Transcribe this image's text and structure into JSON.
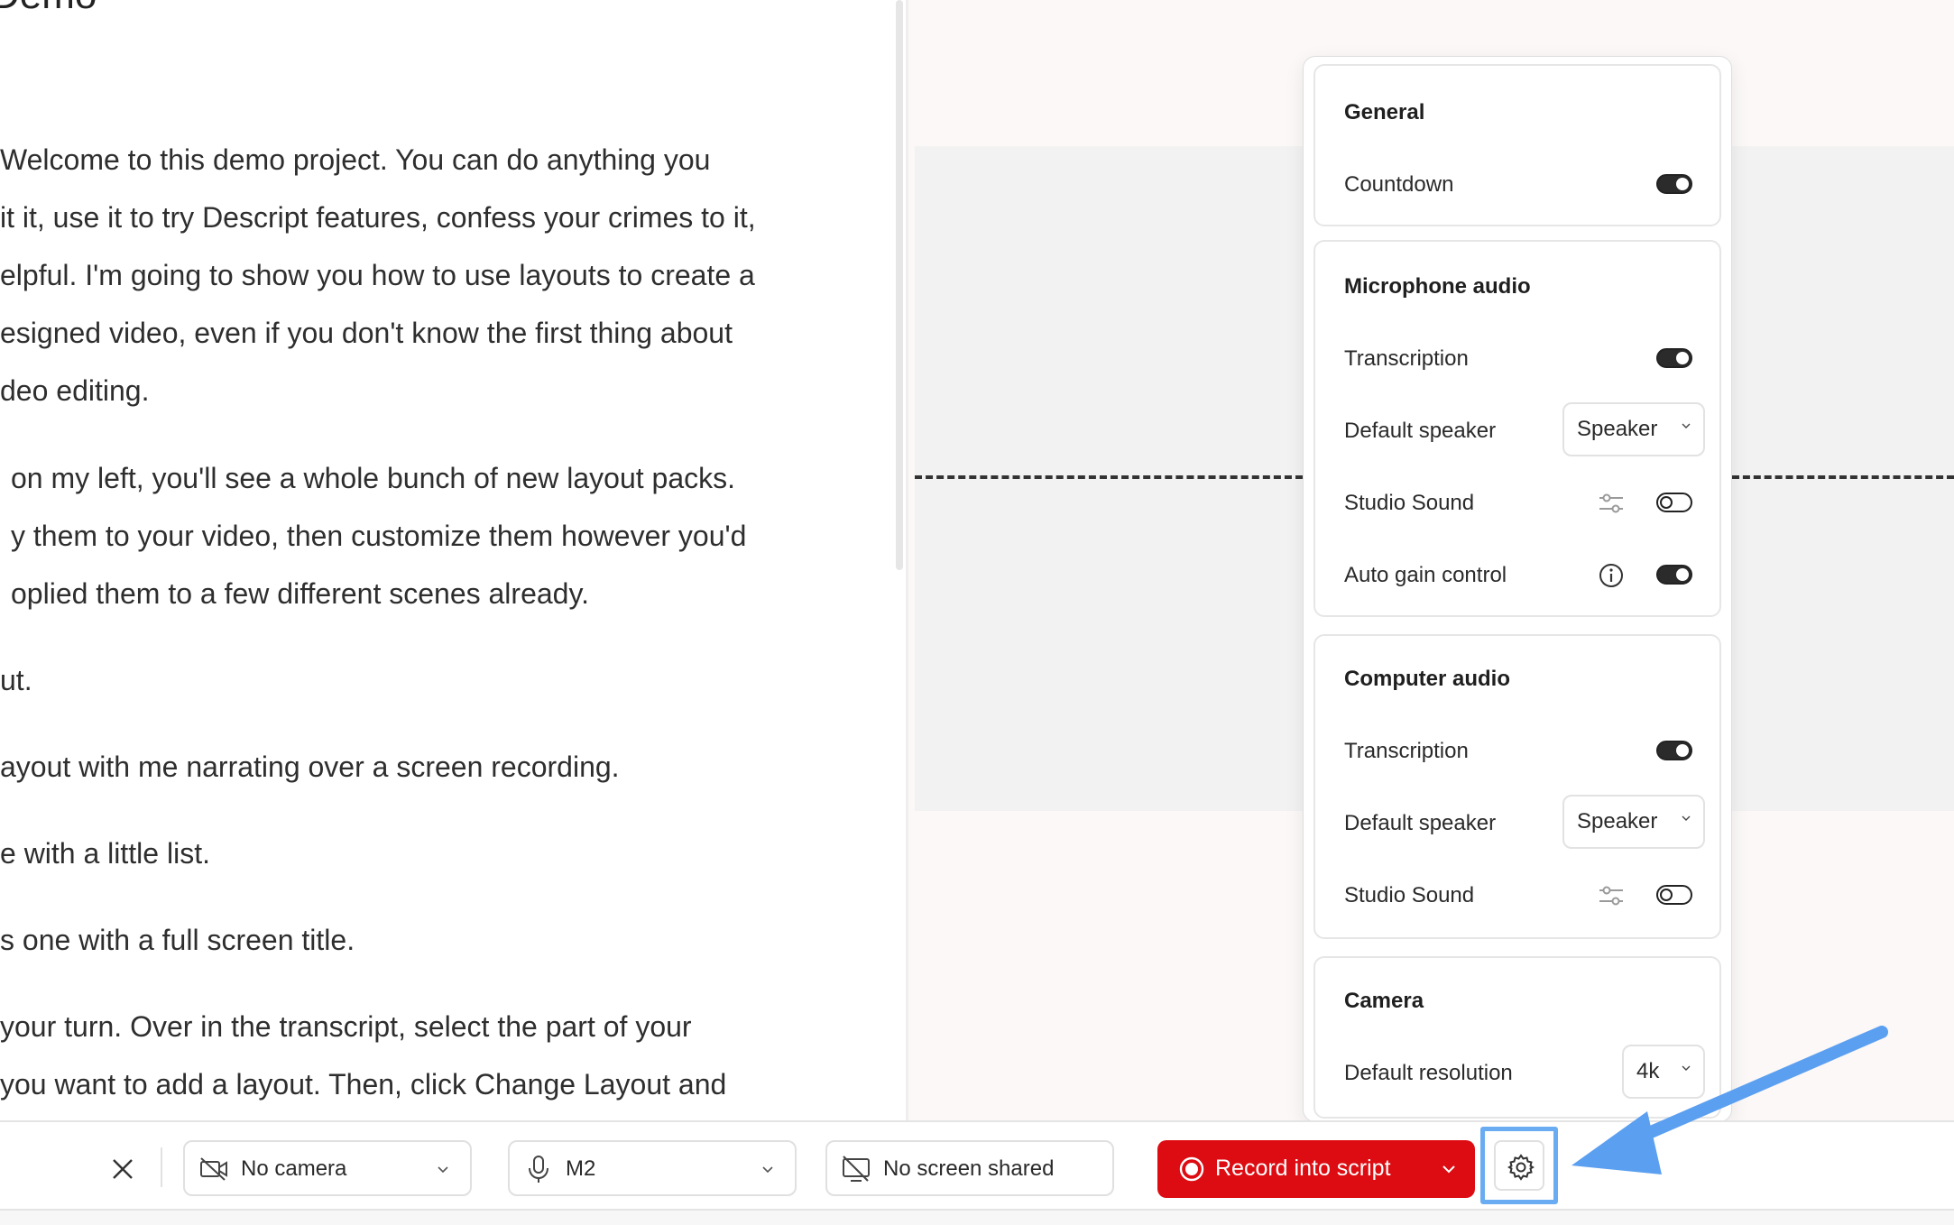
{
  "script": {
    "title": "Demo",
    "paragraphs": [
      [
        "Welcome to this demo project. You can do anything you",
        "it it, use it to try Descript features, confess your crimes to it,",
        "elpful. I'm going to show you how to use layouts to create a",
        "esigned video, even if you don't know the first thing about",
        "deo editing."
      ],
      [
        "on my left, you'll see a whole bunch of new layout packs.",
        "y them to your video, then customize them however you'd",
        "oplied them to a few different scenes already."
      ],
      [
        "ut."
      ],
      [
        "ayout with me narrating over a screen recording."
      ],
      [
        "e with a little list."
      ],
      [
        "s one with a full screen title."
      ],
      [
        "your turn. Over in the transcript, select the part of your",
        "you want to add a layout. Then, click Change Layout and"
      ]
    ]
  },
  "settings": {
    "general": {
      "title": "General",
      "countdown_label": "Countdown",
      "countdown_on": true
    },
    "mic_audio": {
      "title": "Microphone audio",
      "transcription_label": "Transcription",
      "transcription_on": true,
      "default_speaker_label": "Default speaker",
      "default_speaker_value": "Speaker",
      "studio_sound_label": "Studio Sound",
      "studio_sound_on": false,
      "auto_gain_label": "Auto gain control",
      "auto_gain_on": true
    },
    "computer_audio": {
      "title": "Computer audio",
      "transcription_label": "Transcription",
      "transcription_on": true,
      "default_speaker_label": "Default speaker",
      "default_speaker_value": "Speaker",
      "studio_sound_label": "Studio Sound",
      "studio_sound_on": false
    },
    "camera": {
      "title": "Camera",
      "default_resolution_label": "Default resolution",
      "default_resolution_value": "4k"
    }
  },
  "toolbar": {
    "camera_label": "No camera",
    "mic_label": "M2",
    "screen_label": "No screen shared",
    "record_label": "Record into script"
  },
  "colors": {
    "record": "#dc0c12",
    "highlight": "#6aacf2",
    "arrow": "#6aacf2"
  }
}
